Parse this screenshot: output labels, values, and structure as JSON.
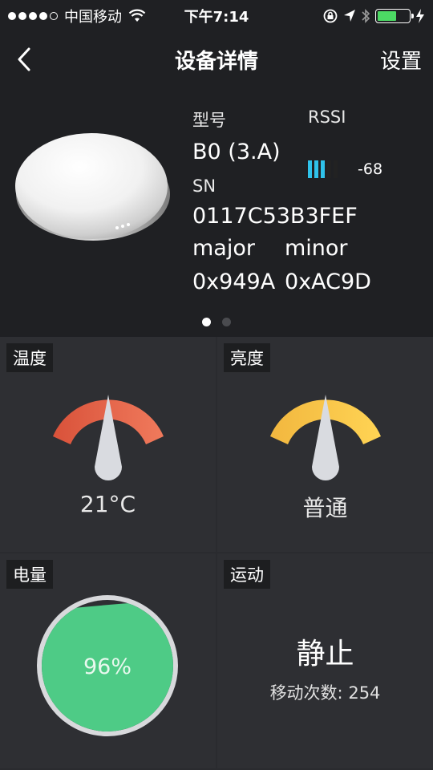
{
  "status_bar": {
    "carrier": "中国移动",
    "time": "下午7:14",
    "battery_level": 0.6,
    "battery_color": "#4cd964"
  },
  "nav": {
    "back_icon": "chevron-left-icon",
    "title": "设备详情",
    "settings_label": "设置"
  },
  "device": {
    "model_label": "型号",
    "model_value": "B0 (3.A)",
    "rssi_label": "RSSI",
    "rssi_value": "-68",
    "rssi_bars_on": 3,
    "rssi_bars_total": 5,
    "rssi_color": "#2fc2ea",
    "sn_label": "SN",
    "sn_value": "0117C53B3FEF",
    "major_label": "major",
    "minor_label": "minor",
    "major_value": "0x949A",
    "minor_value": "0xAC9D",
    "page_count": 2,
    "active_page": 0
  },
  "tiles": {
    "temperature": {
      "label": "温度",
      "value": "21°C",
      "level": 0.5,
      "color_start": "#d9523a",
      "color_end": "#f07a5c"
    },
    "brightness": {
      "label": "亮度",
      "value": "普通",
      "level": 0.5,
      "color_start": "#f2b73f",
      "color_end": "#ffd454"
    },
    "battery": {
      "label": "电量",
      "value": "96%",
      "level": 0.96,
      "color": "#4ecb86"
    },
    "motion": {
      "label": "运动",
      "state": "静止",
      "count_label": "移动次数:",
      "count_value": "254"
    }
  }
}
